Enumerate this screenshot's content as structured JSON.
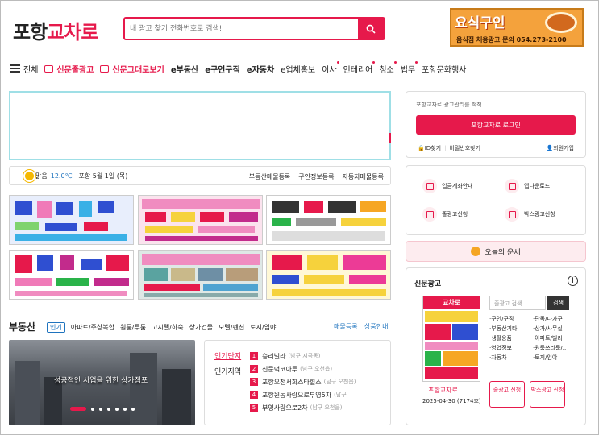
{
  "header": {
    "logo_part1": "포항",
    "logo_part2": "교차로",
    "search_placeholder": "내 광고 찾기 전화번호로 검색!",
    "banner_title": "요식구인",
    "banner_text": "음식점 채용광고 문의 054.273-2100"
  },
  "nav": {
    "all": "전체",
    "items": [
      "신문줄광고",
      "신문그대로보기",
      "e부동산",
      "e구인구직",
      "e자동차",
      "e업체홍보",
      "이사",
      "인테리어",
      "청소",
      "법무",
      "포항문화행사"
    ]
  },
  "weather": {
    "condition": "맑음",
    "temp": "12.0℃",
    "location_date": "포항 5월 1일 (목)",
    "links": [
      "부동산매물등록",
      "구인정보등록",
      "자동차매물등록"
    ]
  },
  "realestate": {
    "title": "부동산",
    "tabs": [
      "인기",
      "아파트/주상복합",
      "원룸/투룸",
      "고시텔/하숙",
      "상가건물",
      "모텔/펜션",
      "토지/임야"
    ],
    "link1": "매물등록",
    "link2": "상품안내",
    "photo_caption": "성공적인 사업을 위한 상가점포",
    "rank_tab1": "인기단지",
    "rank_tab2": "인기지역",
    "ranks": [
      {
        "num": "1",
        "name": "승리빌라",
        "sub": "(남구 지곡동)"
      },
      {
        "num": "2",
        "name": "신문덕코아루",
        "sub": "(남구 오천읍)"
      },
      {
        "num": "3",
        "name": "포항오천서희스타힐스",
        "sub": "(남구 오천읍)"
      },
      {
        "num": "4",
        "name": "포항원동사랑으로부영5차",
        "sub": "(남구 ..."
      },
      {
        "num": "5",
        "name": "부영사랑으로2차",
        "sub": "(남구 오천읍)"
      }
    ]
  },
  "login": {
    "text": "포항교차로 광고관리를 척척",
    "button": "포항교차로 로그인",
    "find_id": "ID찾기",
    "find_pw": "비밀번호찾기",
    "join": "회원가입"
  },
  "quick": [
    "입금계좌안내",
    "앱다운로드",
    "줄광고신청",
    "박스광고신청"
  ],
  "fortune": "오늘의 운세",
  "newspaper": {
    "title": "신문광고",
    "cover": "교차로",
    "caption": "포항교차로",
    "date": "2025-04-30 (7174호)",
    "search_placeholder": "줄광고 검색",
    "search_button": "검색",
    "categories": [
      "구인/구직",
      "단독/다가구",
      "부동산기타",
      "상가/사무실",
      "생활용품",
      "아파트/빌라",
      "영업정보",
      "원룸쓰리룸/..",
      "자동차",
      "토지/임야"
    ],
    "btn1": "줄광고 신청",
    "btn2": "박스광고 신청"
  },
  "colors": {
    "accent": "#e6194b",
    "link": "#1e73be"
  }
}
